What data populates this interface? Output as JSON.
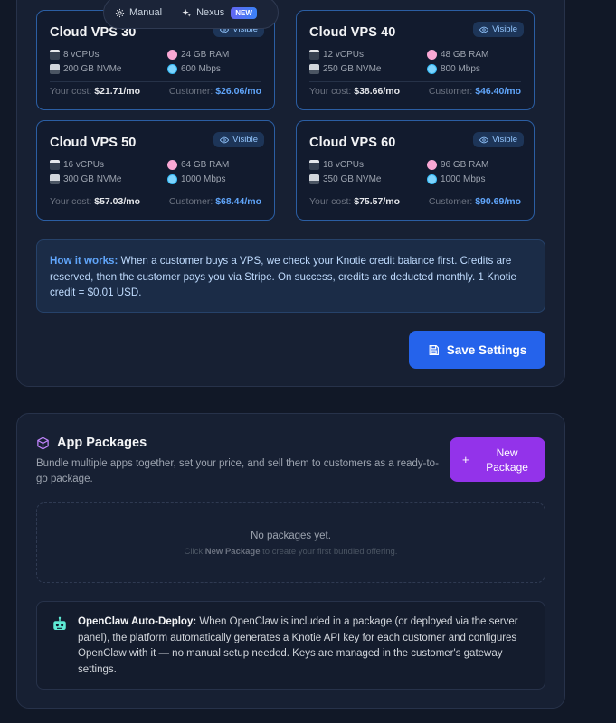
{
  "switcher": {
    "manual_label": "Manual",
    "nexus_label": "Nexus",
    "new_badge": "NEW"
  },
  "vps_cards": [
    {
      "name": "Cloud VPS 30",
      "badge": "Visible",
      "cpu": "8 vCPUs",
      "ram": "24 GB RAM",
      "disk": "200 GB NVMe",
      "net": "600 Mbps",
      "your_cost_label": "Your cost:",
      "your_cost": "$21.71/mo",
      "customer_label": "Customer:",
      "customer_price": "$26.06/mo"
    },
    {
      "name": "Cloud VPS 40",
      "badge": "Visible",
      "cpu": "12 vCPUs",
      "ram": "48 GB RAM",
      "disk": "250 GB NVMe",
      "net": "800 Mbps",
      "your_cost_label": "Your cost:",
      "your_cost": "$38.66/mo",
      "customer_label": "Customer:",
      "customer_price": "$46.40/mo"
    },
    {
      "name": "Cloud VPS 50",
      "badge": "Visible",
      "cpu": "16 vCPUs",
      "ram": "64 GB RAM",
      "disk": "300 GB NVMe",
      "net": "1000 Mbps",
      "your_cost_label": "Your cost:",
      "your_cost": "$57.03/mo",
      "customer_label": "Customer:",
      "customer_price": "$68.44/mo"
    },
    {
      "name": "Cloud VPS 60",
      "badge": "Visible",
      "cpu": "18 vCPUs",
      "ram": "96 GB RAM",
      "disk": "350 GB NVMe",
      "net": "1000 Mbps",
      "your_cost_label": "Your cost:",
      "your_cost": "$75.57/mo",
      "customer_label": "Customer:",
      "customer_price": "$90.69/mo"
    }
  ],
  "how_it_works": {
    "label": "How it works:",
    "text": " When a customer buys a VPS, we check your Knotie credit balance first. Credits are reserved, then the customer pays you via Stripe. On success, credits are deducted monthly. 1 Knotie credit = $0.01 USD."
  },
  "save_button": "Save Settings",
  "app_packages": {
    "title": "App Packages",
    "description": "Bundle multiple apps together, set your price, and sell them to customers as a ready-to-go package.",
    "new_button": "New Package",
    "empty_title": "No packages yet.",
    "empty_sub_prefix": "Click ",
    "empty_sub_bold": "New Package",
    "empty_sub_suffix": " to create your first bundled offering."
  },
  "openclaw": {
    "label": "OpenClaw Auto-Deploy:",
    "text": " When OpenClaw is included in a package (or deployed via the server panel), the platform automatically generates a Knotie API key for each customer and configures OpenClaw with it — no manual setup needed. Keys are managed in the customer's gateway settings."
  },
  "colors": {
    "card_border": "#2b5ea3",
    "accent_blue": "#2563eb",
    "accent_purple": "#9333ea",
    "customer_price": "#60a5fa"
  },
  "icons": {
    "cpu": "cpu-icon",
    "ram": "brain-icon",
    "disk": "disk-icon",
    "net": "globe-icon",
    "visible": "eye-icon",
    "save": "floppy-icon",
    "package": "cube-icon",
    "robot": "robot-icon"
  }
}
